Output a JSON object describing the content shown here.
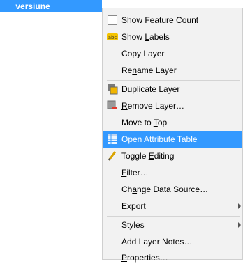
{
  "layer": {
    "name": "__versiune"
  },
  "menu": {
    "items": [
      {
        "label": "Show Feature Count",
        "icon": "checkbox-icon",
        "underline": "C"
      },
      {
        "label": "Show Labels",
        "icon": "labels-icon",
        "underline": "L"
      },
      {
        "label": "Copy Layer",
        "icon": "",
        "underline": ""
      },
      {
        "label": "Rename Layer",
        "icon": "",
        "underline": "n"
      },
      {
        "label": "Duplicate Layer",
        "icon": "duplicate-layer-icon",
        "underline": "D"
      },
      {
        "label": "Remove Layer…",
        "icon": "remove-layer-icon",
        "underline": "R"
      },
      {
        "label": "Move to Top",
        "icon": "",
        "underline": "T"
      },
      {
        "label": "Open Attribute Table",
        "icon": "attribute-table-icon",
        "underline": "A"
      },
      {
        "label": "Toggle Editing",
        "icon": "pencil-icon",
        "underline": "E"
      },
      {
        "label": "Filter…",
        "icon": "",
        "underline": "F"
      },
      {
        "label": "Change Data Source…",
        "icon": "",
        "underline": "a"
      },
      {
        "label": "Export",
        "icon": "",
        "underline": "x"
      },
      {
        "label": "Styles",
        "icon": "",
        "underline": ""
      },
      {
        "label": "Add Layer Notes…",
        "icon": "",
        "underline": ""
      },
      {
        "label": "Properties…",
        "icon": "",
        "underline": "P"
      }
    ]
  },
  "colors": {
    "selection": "#3399ff",
    "menu_bg": "#f2f2f2"
  }
}
